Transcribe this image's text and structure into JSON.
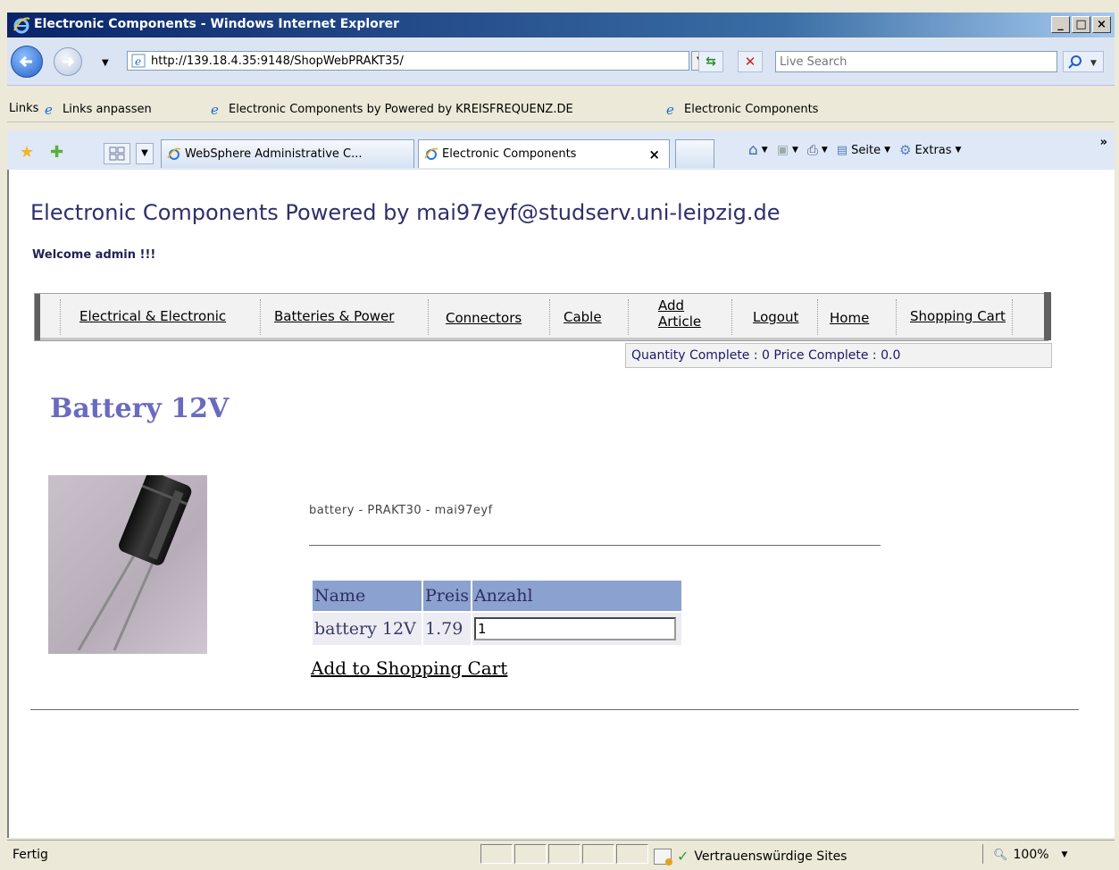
{
  "window": {
    "title": "Electronic Components - Windows Internet Explorer",
    "controls": {
      "minimize": "_",
      "maximize": "□",
      "close": "×"
    }
  },
  "address_bar": {
    "url": "http://139.18.4.35:9148/ShopWebPRAKT35/",
    "search_placeholder": "Live Search"
  },
  "links_bar": {
    "label": "Links",
    "items": [
      {
        "label": "Links anpassen"
      },
      {
        "label": "Electronic Components by Powered by KREISFREQUENZ.DE"
      },
      {
        "label": "Electronic Components"
      }
    ]
  },
  "tabs": [
    {
      "label": "WebSphere Administrative C...",
      "active": false
    },
    {
      "label": "Electronic Components",
      "active": true,
      "close": "×"
    }
  ],
  "command_bar": {
    "page": "Seite",
    "extras": "Extras",
    "more": "»"
  },
  "page": {
    "site_title": "Electronic Components Powered by mai97eyf@studserv.uni-leipzig.de",
    "welcome": "Welcome admin !!!",
    "menu": [
      {
        "label": "Electrical & Electronic"
      },
      {
        "label": "Batteries & Power"
      },
      {
        "label": "Connectors"
      },
      {
        "label": "Cable"
      },
      {
        "label_line1": "Add",
        "label_line2": "Article"
      },
      {
        "label": "Logout"
      },
      {
        "label": "Home"
      },
      {
        "label": "Shopping Cart"
      }
    ],
    "cart_status": "Quantity Complete : 0  Price Complete :   0.0",
    "product": {
      "title": "Battery 12V",
      "description": "battery - PRAKT30 - mai97eyf",
      "table": {
        "headers": [
          "Name",
          "Preis",
          "Anzahl"
        ],
        "row": {
          "name": "battery 12V",
          "price": "1.79",
          "quantity": "1"
        }
      },
      "add_to_cart": "Add to Shopping Cart"
    }
  },
  "status_bar": {
    "status": "Fertig",
    "zone": "Vertrauenswürdige Sites",
    "zoom": "100%"
  },
  "colors": {
    "title_bar": "#0a246a",
    "product_title": "#6a6ac0",
    "table_header": "#8ba1d0",
    "site_title": "#2f2f6b"
  }
}
